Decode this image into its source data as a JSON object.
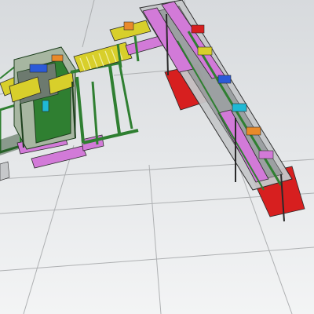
{
  "viewport": {
    "background_top": "#d7dadd",
    "background_bottom": "#f3f4f5",
    "grid_color": "#a8aaac"
  },
  "model": {
    "colors": {
      "frame_green": "#2f7f31",
      "frame_dark": "#1d3f1d",
      "conveyor_yellow": "#d8cf2b",
      "roller_light": "#f1efa3",
      "base_magenta": "#d27ad8",
      "support_red": "#d71f1f",
      "sheet_gray": "#c6c8ca",
      "outline": "#2a2a2a",
      "accent_blue": "#2b5ad8",
      "accent_cyan": "#1fb9d5",
      "accent_orange": "#e98a2a"
    }
  }
}
